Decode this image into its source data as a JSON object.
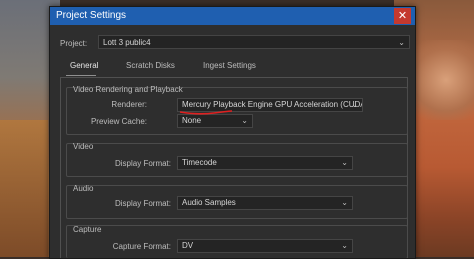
{
  "dialog": {
    "title": "Project Settings",
    "close_glyph": "✕",
    "project_label": "Project:",
    "project_value": "Lott 3 public4"
  },
  "tabs": [
    {
      "label": "General",
      "active": true
    },
    {
      "label": "Scratch Disks",
      "active": false
    },
    {
      "label": "Ingest Settings",
      "active": false
    }
  ],
  "sections": {
    "video_rendering": {
      "title": "Video Rendering and Playback",
      "renderer_label": "Renderer:",
      "renderer_value": "Mercury Playback Engine GPU Acceleration (CUDA)",
      "preview_cache_label": "Preview Cache:",
      "preview_cache_value": "None"
    },
    "video": {
      "title": "Video",
      "display_format_label": "Display Format:",
      "display_format_value": "Timecode"
    },
    "audio": {
      "title": "Audio",
      "display_format_label": "Display Format:",
      "display_format_value": "Audio Samples"
    },
    "capture": {
      "title": "Capture",
      "capture_format_label": "Capture Format:",
      "capture_format_value": "DV"
    }
  },
  "icons": {
    "dropdown": "chevron-down-icon",
    "close": "close-icon"
  },
  "colors": {
    "titlebar": "#1f5fb0",
    "close_button": "#c4392f",
    "annotation_underline": "#e02020"
  }
}
